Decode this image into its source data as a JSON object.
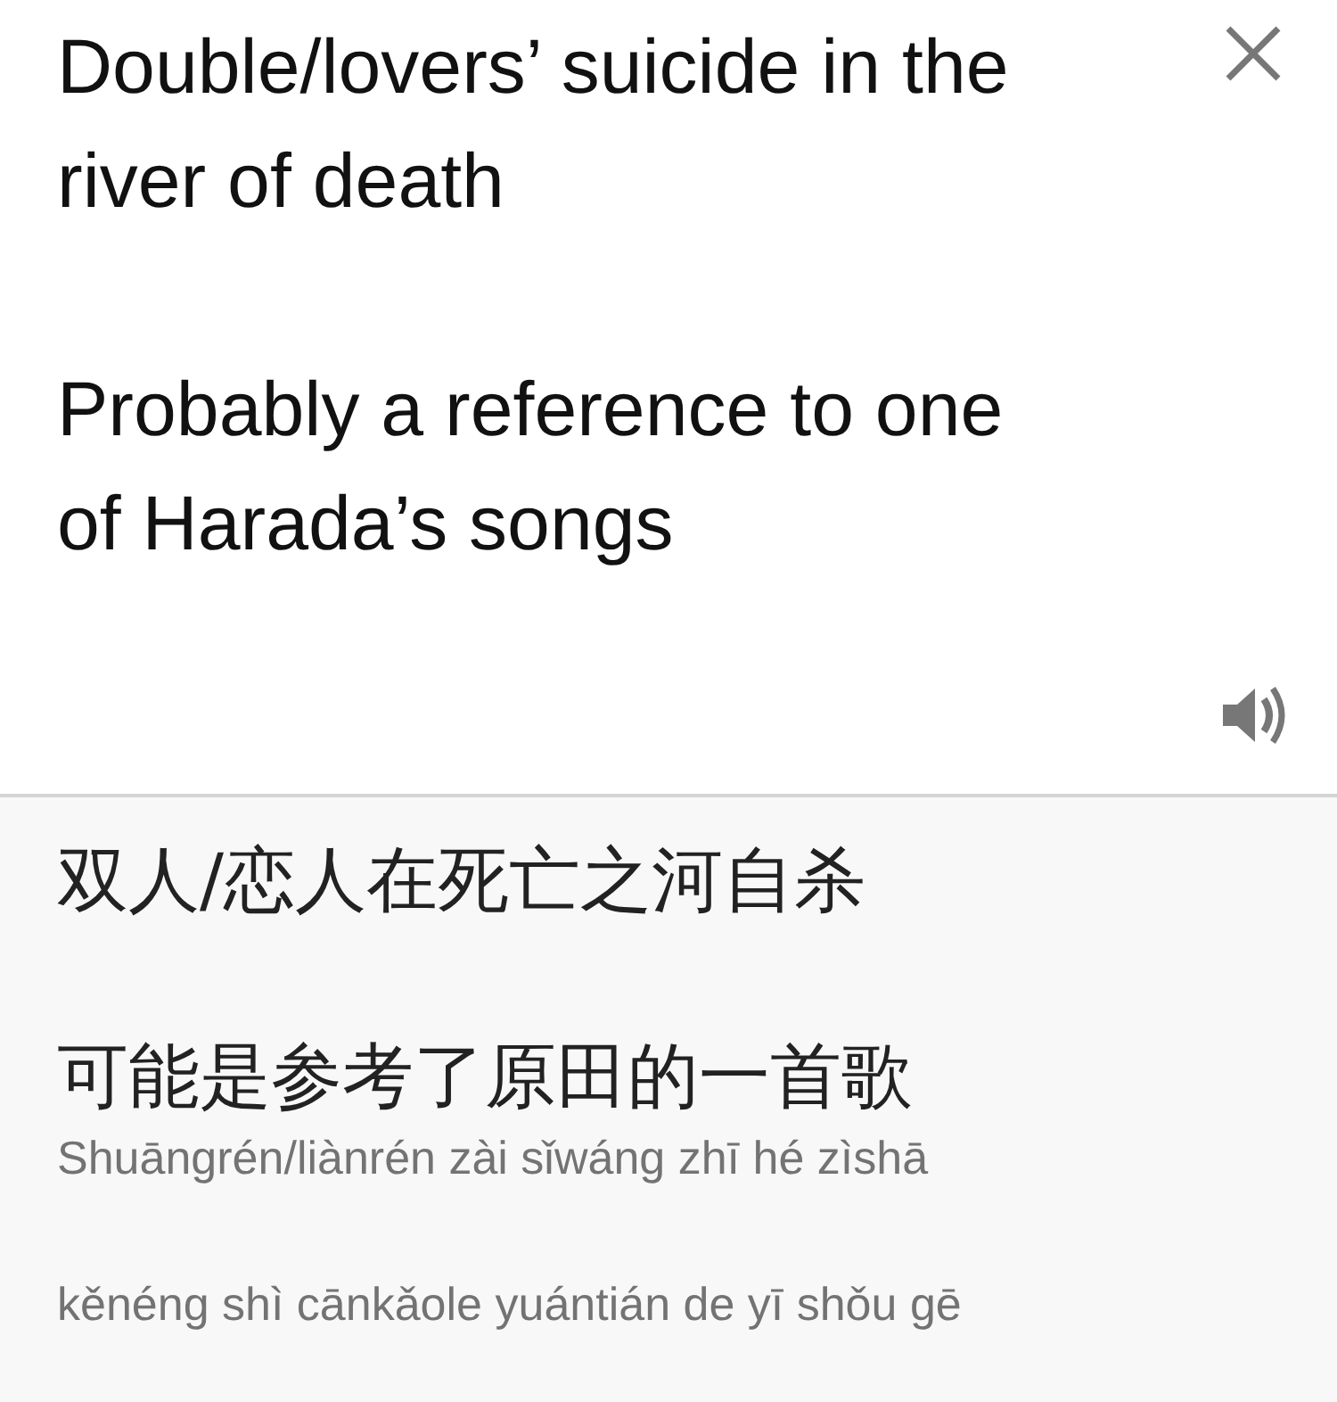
{
  "source": {
    "paragraphs": [
      "Double/lovers’ suicide in the river of death",
      "Probably a reference to one of Harada’s songs"
    ]
  },
  "translation": {
    "paragraphs": [
      "双人/恋人在死亡之河自杀",
      "可能是参考了原田的一首歌"
    ],
    "romanization": [
      "Shuāngrén/liànrén zài sǐwáng zhī hé zìshā",
      "kěnéng shì cānkǎole yuántián de yī shǒu gē"
    ]
  }
}
